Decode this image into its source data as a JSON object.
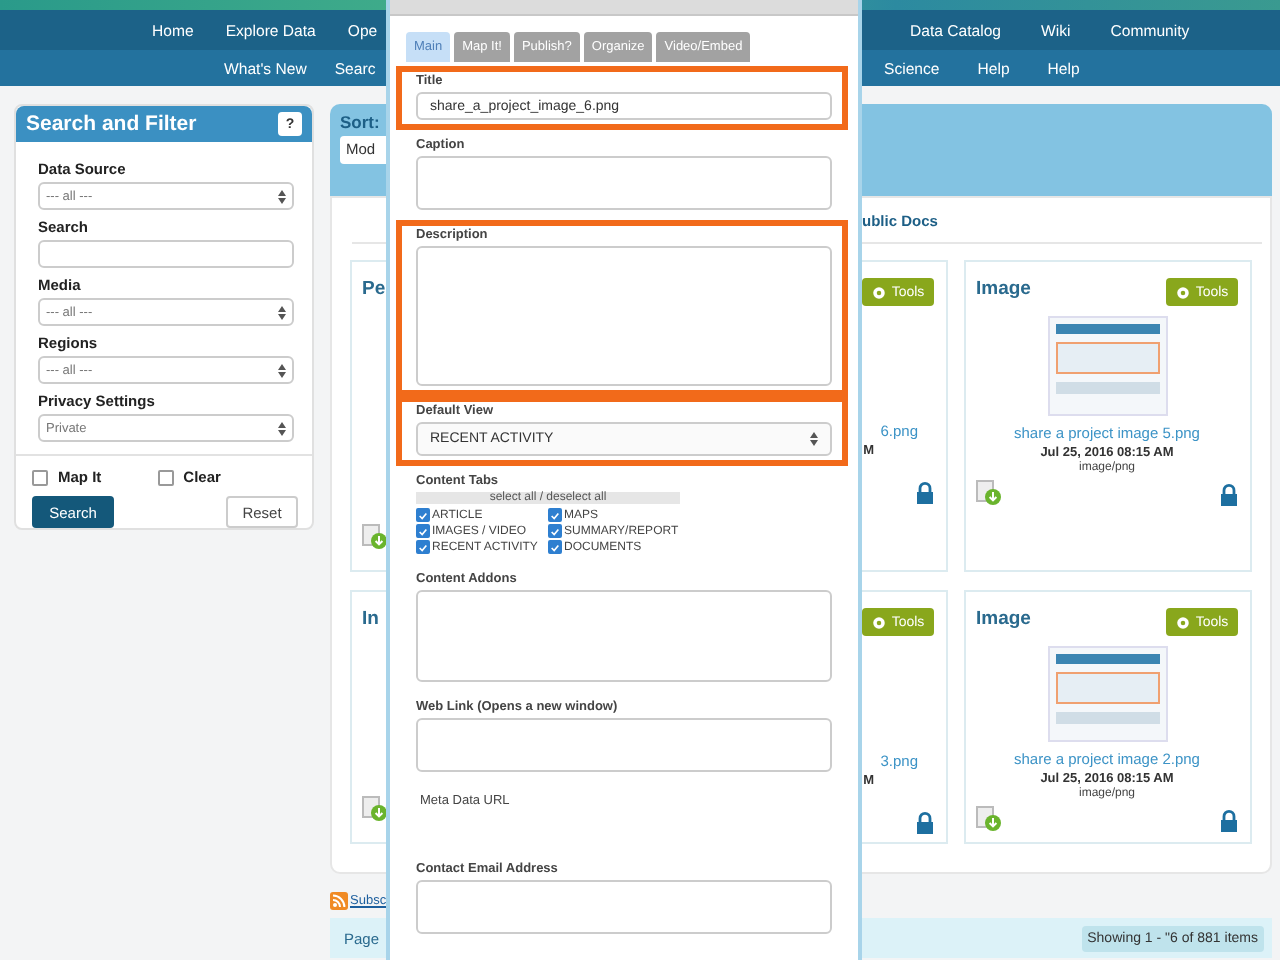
{
  "nav_primary": {
    "left_items": [
      "Home",
      "Explore Data",
      "Ope"
    ],
    "right_items": [
      "Data Catalog",
      "Wiki",
      "Community"
    ]
  },
  "nav_secondary": {
    "left_items": [
      "What's New",
      "Searc"
    ],
    "right_items": [
      "Science",
      "Help",
      "Help"
    ]
  },
  "sidebar": {
    "title": "Search and Filter",
    "help_button": "?",
    "fields": [
      {
        "label": "Data Source",
        "kind": "select",
        "value": "--- all ---"
      },
      {
        "label": "Search",
        "kind": "input"
      },
      {
        "label": "Media",
        "kind": "select",
        "value": "--- all ---"
      },
      {
        "label": "Regions",
        "kind": "select",
        "value": "--- all ---"
      },
      {
        "label": "Privacy Settings",
        "kind": "select",
        "value": "Private"
      }
    ],
    "checkboxes": [
      {
        "label": "Map It",
        "checked": false
      },
      {
        "label": "Clear",
        "checked": false
      }
    ],
    "search_button": "Search",
    "reset_button": "Reset"
  },
  "main": {
    "sort_label": "Sort:",
    "sort_value": "Mod",
    "tab_label": "ublic Docs",
    "cards": [
      {
        "kind": "left-edge",
        "title": "Pe"
      },
      {
        "kind": "right-edge",
        "tools": "Tools",
        "link": "6.png",
        "date": "M",
        "locked": true
      },
      {
        "kind": "full",
        "title": "Image",
        "tools": "Tools",
        "link": "share a project image 5.png",
        "date": "Jul 25, 2016 08:15 AM",
        "type": "image/png",
        "locked": true
      },
      {
        "kind": "left-edge",
        "title": "In"
      },
      {
        "kind": "right-edge",
        "tools": "Tools",
        "link": "3.png",
        "date": "M",
        "locked": true
      },
      {
        "kind": "full",
        "title": "Image",
        "tools": "Tools",
        "link": "share a project image 2.png",
        "date": "Jul 25, 2016 08:15 AM",
        "type": "image/png",
        "locked": true
      }
    ]
  },
  "footer": {
    "subscribe": "Subsc",
    "page_label": "Page",
    "showing": "Showing 1 - \"6 of 881 items"
  },
  "modal": {
    "tabs": [
      {
        "label": "Main",
        "selected": true
      },
      {
        "label": "Map It!",
        "selected": false
      },
      {
        "label": "Publish?",
        "selected": false
      },
      {
        "label": "Organize",
        "selected": false
      },
      {
        "label": "Video/Embed",
        "selected": false
      }
    ],
    "fields": [
      {
        "kind": "line",
        "label": "Title",
        "value": "share_a_project_image_6.png",
        "highlighted": true
      },
      {
        "kind": "area",
        "label": "Caption",
        "highlighted": false
      },
      {
        "kind": "area-large",
        "label": "Description",
        "highlighted": true
      },
      {
        "kind": "select",
        "label": "Default View",
        "value": "RECENT ACTIVITY",
        "highlighted": true
      },
      {
        "kind": "checklist",
        "label": "Content Tabs",
        "select_all": "select all / deselect all",
        "options": [
          {
            "label": "ARTICLE",
            "checked": true
          },
          {
            "label": "MAPS",
            "checked": true
          },
          {
            "label": "IMAGES / VIDEO",
            "checked": true
          },
          {
            "label": "SUMMARY/REPORT",
            "checked": true
          },
          {
            "label": "RECENT ACTIVITY",
            "checked": true
          },
          {
            "label": "DOCUMENTS",
            "checked": true
          }
        ]
      },
      {
        "kind": "area-medium",
        "label": "Content Addons",
        "highlighted": false
      },
      {
        "kind": "area",
        "label": "Web Link (Opens a new window)",
        "highlighted": false
      },
      {
        "kind": "static",
        "label": "Meta Data URL"
      },
      {
        "kind": "area",
        "label": "Contact Email Address",
        "highlighted": false
      }
    ]
  }
}
